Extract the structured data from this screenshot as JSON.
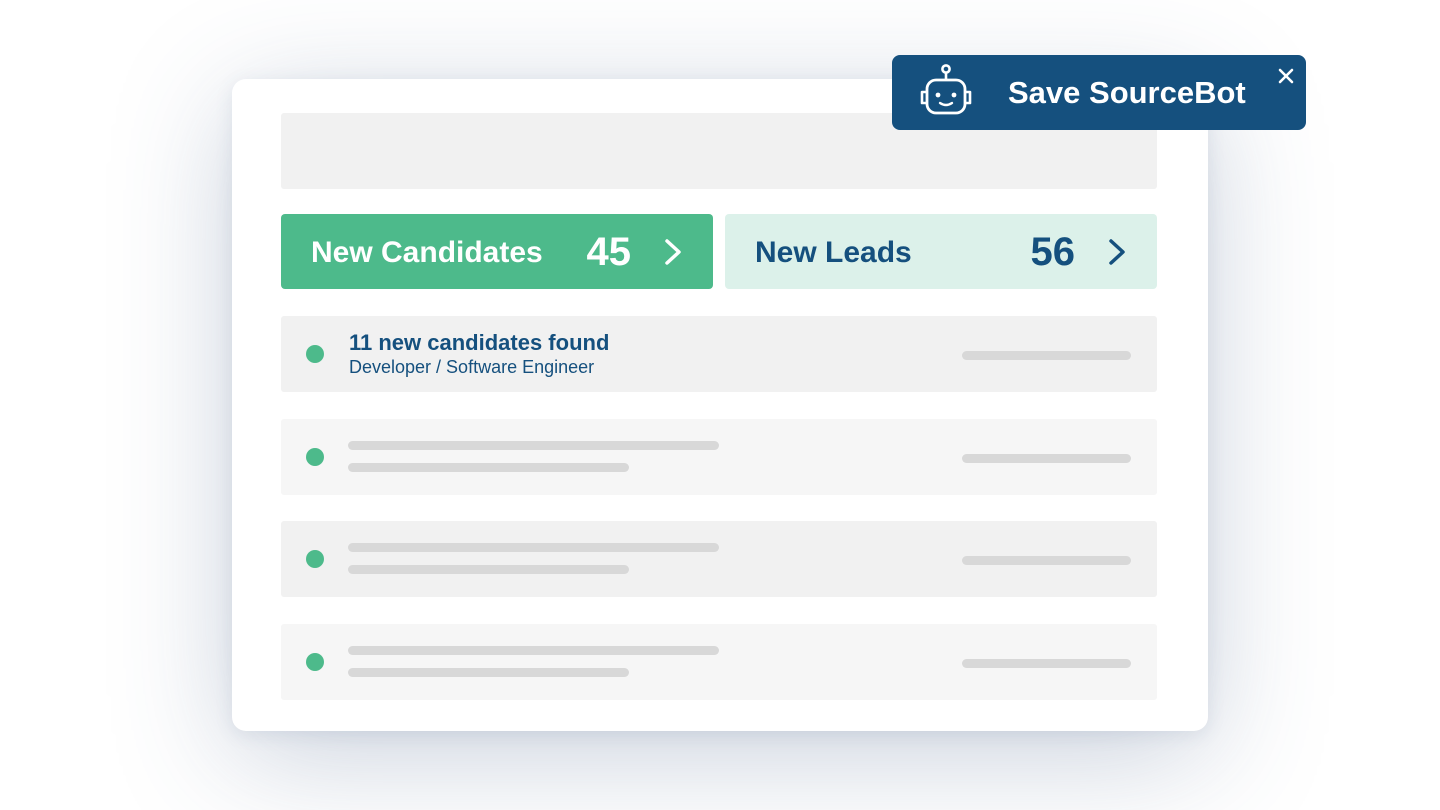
{
  "stats": {
    "candidates": {
      "label": "New Candidates",
      "count": "45"
    },
    "leads": {
      "label": "New Leads",
      "count": "56"
    }
  },
  "list": {
    "first_item": {
      "title": "11 new candidates found",
      "subtitle": "Developer / Software Engineer"
    }
  },
  "toast": {
    "title": "Save SourceBot",
    "icon": "robot-icon",
    "close_icon": "close-icon"
  },
  "colors": {
    "primary_green": "#4dba8b",
    "light_green": "#dcf1ea",
    "navy": "#15507e",
    "placeholder_gray": "#f1f1f1",
    "skeleton_bar": "#d8d8d8"
  }
}
